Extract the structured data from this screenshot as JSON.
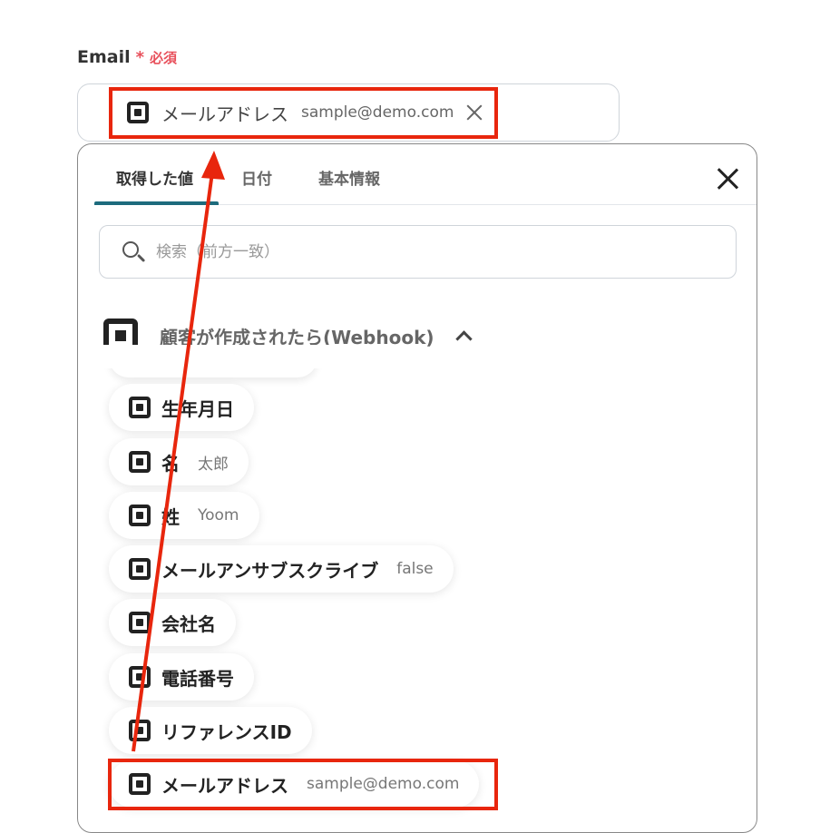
{
  "field": {
    "label": "Email",
    "required_star": "*",
    "required_text": "必須"
  },
  "selected": {
    "name": "メールアドレス",
    "value": "sample@demo.com"
  },
  "tabs": [
    {
      "label": "取得した値",
      "active": true
    },
    {
      "label": "日付",
      "active": false
    },
    {
      "label": "基本情報",
      "active": false
    }
  ],
  "search": {
    "placeholder": "検索（前方一致）"
  },
  "group": {
    "title": "顧客が作成されたら(Webhook)"
  },
  "items": [
    {
      "name": "生年月日",
      "value": ""
    },
    {
      "name": "名",
      "value": "太郎"
    },
    {
      "name": "姓",
      "value": "Yoom"
    },
    {
      "name": "メールアンサブスクライブ",
      "value": "false"
    },
    {
      "name": "会社名",
      "value": ""
    },
    {
      "name": "電話番号",
      "value": ""
    },
    {
      "name": "リファレンスID",
      "value": ""
    },
    {
      "name": "メールアドレス",
      "value": "sample@demo.com"
    }
  ],
  "colors": {
    "highlight": "#e8260d",
    "tab_accent": "#1d6b7d",
    "required": "#e8505b"
  },
  "icons": {
    "item": "square-app-icon",
    "remove": "close-icon",
    "panel_close": "close-icon",
    "search": "search-icon",
    "collapse": "chevron-up-icon"
  }
}
